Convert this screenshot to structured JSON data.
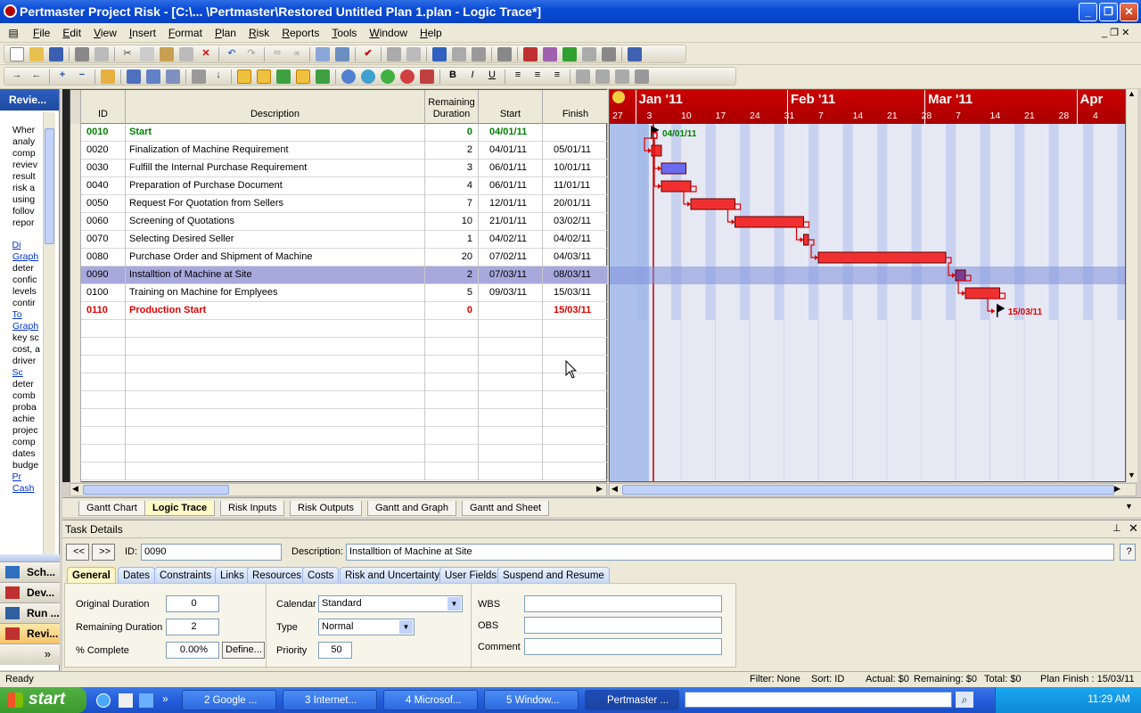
{
  "window": {
    "title": "Pertmaster Project Risk - [C:\\... \\Pertmaster\\Restored Untitled Plan 1.plan - Logic Trace*]"
  },
  "menu": [
    "File",
    "Edit",
    "View",
    "Insert",
    "Format",
    "Plan",
    "Risk",
    "Reports",
    "Tools",
    "Window",
    "Help"
  ],
  "left_panel": {
    "header": "Revie...",
    "text_lines": [
      "Wher",
      "analy",
      "comp",
      "reviev",
      "result",
      "risk a",
      "using",
      "follov",
      "repor"
    ],
    "bullets": [
      {
        "link": [
          "Di",
          "Graph"
        ],
        "text": [
          "deter",
          "confic",
          "levels",
          "contir"
        ]
      },
      {
        "link": [
          "To",
          "Graph"
        ],
        "text": [
          "key sc",
          "cost, a",
          "driver"
        ]
      },
      {
        "link": [
          "Sc"
        ],
        "text": [
          "deter",
          "comb",
          "proba",
          "achie",
          "projec",
          "comp",
          "dates",
          "budge"
        ]
      },
      {
        "link": [
          "Pr",
          "Cash"
        ],
        "text": []
      }
    ],
    "nav": [
      "Sch...",
      "Dev...",
      "Run ...",
      "Revi..."
    ]
  },
  "grid": {
    "headers": {
      "id": "ID",
      "desc": "Description",
      "rem": "Remaining Duration",
      "start": "Start",
      "finish": "Finish"
    },
    "rows": [
      {
        "id": "0010",
        "desc": "Start",
        "rem": "0",
        "start": "04/01/11",
        "finish": ""
      },
      {
        "id": "0020",
        "desc": "Finalization of Machine Requirement",
        "rem": "2",
        "start": "04/01/11",
        "finish": "05/01/11"
      },
      {
        "id": "0030",
        "desc": "Fulfill the Internal Purchase Requirement",
        "rem": "3",
        "start": "06/01/11",
        "finish": "10/01/11"
      },
      {
        "id": "0040",
        "desc": "Preparation of Purchase  Document",
        "rem": "4",
        "start": "06/01/11",
        "finish": "11/01/11"
      },
      {
        "id": "0050",
        "desc": "Request For Quotation from Sellers",
        "rem": "7",
        "start": "12/01/11",
        "finish": "20/01/11"
      },
      {
        "id": "0060",
        "desc": "Screening of Quotations",
        "rem": "10",
        "start": "21/01/11",
        "finish": "03/02/11"
      },
      {
        "id": "0070",
        "desc": "Selecting Desired Seller",
        "rem": "1",
        "start": "04/02/11",
        "finish": "04/02/11"
      },
      {
        "id": "0080",
        "desc": "Purchase Order and Shipment of Machine",
        "rem": "20",
        "start": "07/02/11",
        "finish": "04/03/11"
      },
      {
        "id": "0090",
        "desc": "Installtion of Machine at Site",
        "rem": "2",
        "start": "07/03/11",
        "finish": "08/03/11"
      },
      {
        "id": "0100",
        "desc": "Training on Machine for Emplyees",
        "rem": "5",
        "start": "09/03/11",
        "finish": "15/03/11"
      },
      {
        "id": "0110",
        "desc": "Production Start",
        "rem": "0",
        "start": "",
        "finish": "15/03/11"
      }
    ]
  },
  "gantt": {
    "months": [
      "Jan '11",
      "Feb '11",
      "Mar '11",
      "Apr"
    ],
    "weeks": [
      "27",
      "3",
      "10",
      "17",
      "24",
      "31",
      "7",
      "14",
      "21",
      "28",
      "7",
      "14",
      "21",
      "28",
      "4"
    ],
    "start_label": "04/01/11",
    "finish_label": "15/03/11"
  },
  "view_tabs": [
    "Gantt Chart",
    "Logic Trace",
    "Risk Inputs",
    "Risk Outputs",
    "Gantt and Graph",
    "Gantt and Sheet"
  ],
  "task_details": {
    "title": "Task Details",
    "nav_prev": "<<",
    "nav_next": ">>",
    "id_label": "ID:",
    "id_value": "0090",
    "desc_label": "Description:",
    "desc_value": "Installtion of Machine at Site",
    "help": "?",
    "tabs": [
      "General",
      "Dates",
      "Constraints",
      "Links",
      "Resources",
      "Costs",
      "Risk and Uncertainty",
      "User Fields",
      "Suspend and Resume"
    ],
    "general": {
      "orig_dur_label": "Original Duration",
      "orig_dur": "0",
      "rem_dur_label": "Remaining Duration",
      "rem_dur": "2",
      "pct_label": "% Complete",
      "pct": "0.00%",
      "define_label": "Define...",
      "calendar_label": "Calendar",
      "calendar": "Standard",
      "type_label": "Type",
      "type": "Normal",
      "priority_label": "Priority",
      "priority": "50",
      "wbs_label": "WBS",
      "obs_label": "OBS",
      "comment_label": "Comment"
    }
  },
  "status": {
    "ready": "Ready",
    "filter": "Filter: None",
    "sort": "Sort: ID",
    "actual": "Actual: $0",
    "remaining": "Remaining: $0",
    "total": "Total: $0",
    "plan_finish": "Plan Finish : 15/03/11"
  },
  "taskbar": {
    "start": "start",
    "items": [
      "2 Google ...",
      "3 Internet...",
      "4 Microsof...",
      "5 Window...",
      "Pertmaster ..."
    ],
    "clock": "11:29 AM"
  }
}
